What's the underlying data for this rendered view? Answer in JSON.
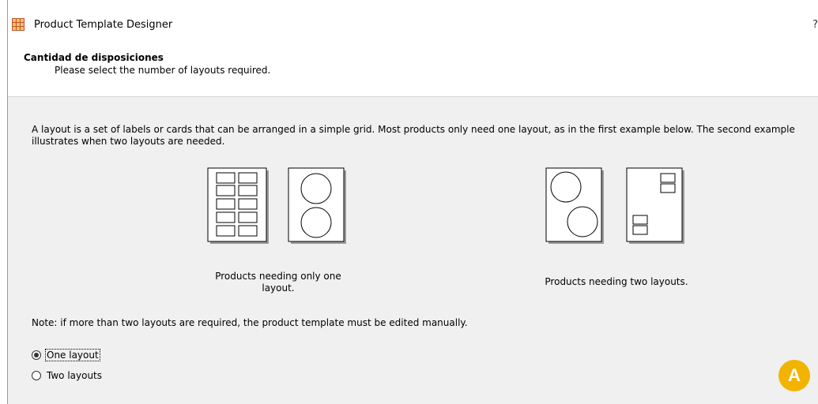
{
  "window": {
    "title": "Product Template Designer",
    "help_label": "?",
    "icon": "grid-app-icon"
  },
  "header": {
    "title": "Cantidad de disposiciones",
    "subtitle": "Please select the number of layouts required."
  },
  "content": {
    "intro": "A layout is a set of labels or cards that can be arranged in a simple grid.  Most products only need one layout, as in the first example below.  The second example illustrates when two layouts are needed.",
    "examples": [
      {
        "caption_line1": "Products needing only one",
        "caption_line2": "layout."
      },
      {
        "caption": "Products needing two layouts."
      }
    ],
    "note": "Note: if more than two layouts are required, the product template must be edited manually."
  },
  "options": {
    "selected": "one",
    "items": [
      {
        "id": "one",
        "label": "One layout"
      },
      {
        "id": "two",
        "label": "Two layouts"
      }
    ]
  },
  "badge": {
    "label": "A",
    "color": "#f2b400"
  }
}
